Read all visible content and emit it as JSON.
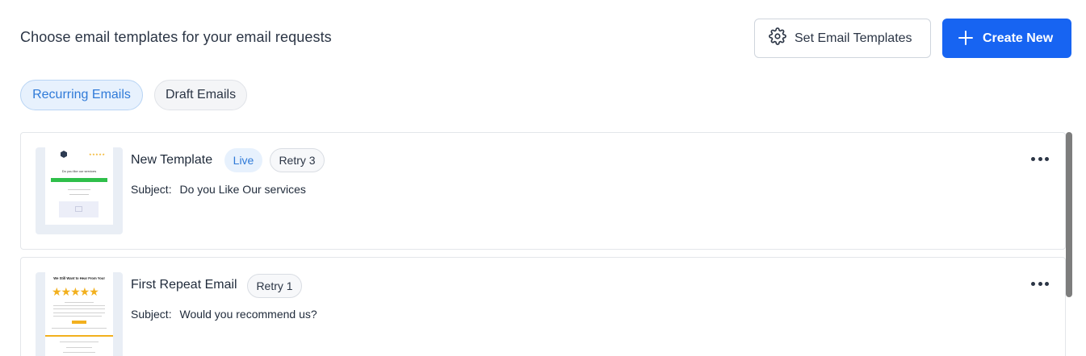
{
  "header": {
    "title": "Choose email templates for your email requests",
    "set_templates_label": "Set Email Templates",
    "create_new_label": "Create New",
    "create_new_icon": "plus-icon",
    "set_templates_icon": "gear-icon"
  },
  "tabs": [
    {
      "label": "Recurring Emails",
      "active": true
    },
    {
      "label": "Draft Emails",
      "active": false
    }
  ],
  "templates": [
    {
      "name": "New Template",
      "status": "Live",
      "retry": "Retry 3",
      "subject_label": "Subject:",
      "subject": "Do you Like Our services",
      "thumb_heading": "Do you like our services"
    },
    {
      "name": "First Repeat Email",
      "retry": "Retry 1",
      "subject_label": "Subject:",
      "subject": "Would you recommend us?",
      "thumb_heading": "We Still Want to Hear From You!",
      "thumb_stars": "★★★★★"
    }
  ],
  "colors": {
    "primary": "#1764f2",
    "tab_active_bg": "#e7f1fd",
    "tab_active_text": "#2f7ad8",
    "star": "#f2b01e",
    "green_bar": "#2fbf4a"
  }
}
